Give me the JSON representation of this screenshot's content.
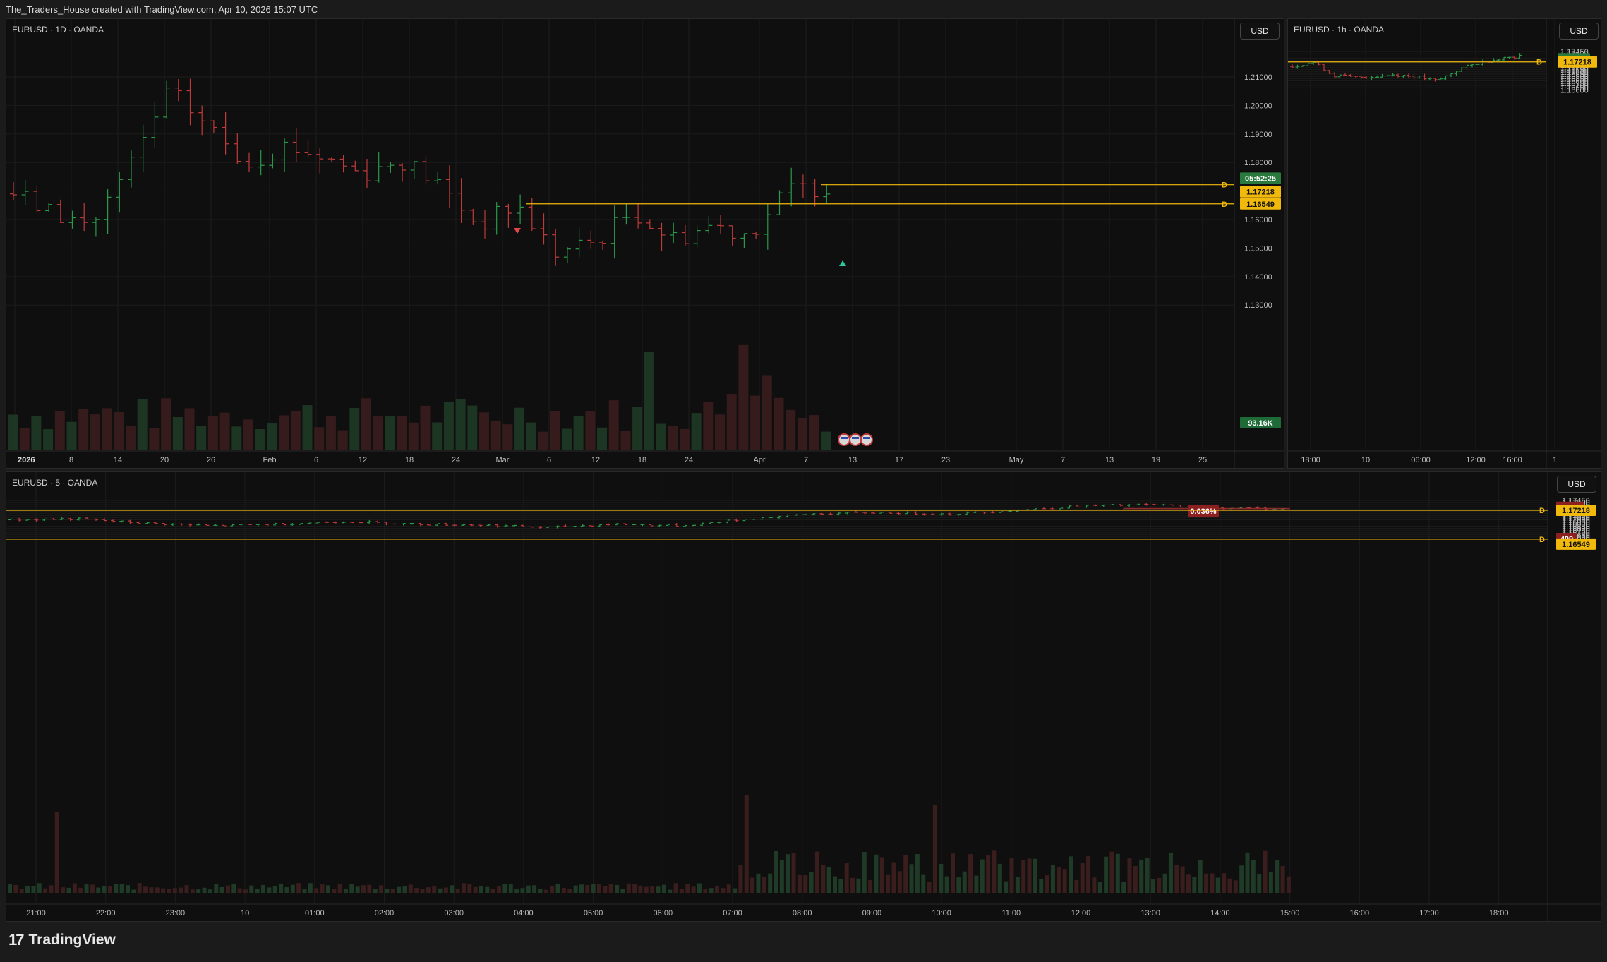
{
  "header": {
    "text": "The_Traders_House created with TradingView.com, Apr 10, 2026 15:07 UTC"
  },
  "footer": {
    "brand": "TradingView",
    "logo_glyph": "17"
  },
  "colors": {
    "up": "#2a9a4a",
    "down": "#c03a3a",
    "level": "#f0b90b",
    "grid": "#1c1c1c",
    "text": "#bdbdbd"
  },
  "currency_button": "USD",
  "pane_daily": {
    "legend": "EURUSD · 1D · OANDA",
    "price_ticks": [
      "1.21000",
      "1.20000",
      "1.19000",
      "1.18000",
      "1.16000",
      "1.15000",
      "1.14000",
      "1.13000"
    ],
    "time_labels": [
      "2026",
      "8",
      "14",
      "20",
      "26",
      "Feb",
      "6",
      "12",
      "18",
      "24",
      "Mar",
      "6",
      "12",
      "18",
      "24",
      "Apr",
      "7",
      "13",
      "17",
      "23",
      "May",
      "7",
      "13",
      "19",
      "25"
    ],
    "badges": {
      "countdown": "05:52:25",
      "price1": "1.17218",
      "price2": "1.16549",
      "volume": "93.16K"
    },
    "level_markers": [
      "D",
      "D"
    ],
    "event_icons": [
      "us-flag-icon",
      "us-flag-icon",
      "us-flag-icon"
    ]
  },
  "pane_hourly": {
    "legend": "EURUSD · 1h · OANDA",
    "price_ticks": [
      "1.17450",
      "1.17400",
      "1.17350",
      "1.17300",
      "1.17250",
      "1.17200",
      "1.17150",
      "1.17100",
      "1.17050",
      "1.17000",
      "1.16950",
      "1.16900",
      "1.16850",
      "1.16800",
      "1.16750",
      "1.16700",
      "1.16650",
      "1.16600"
    ],
    "time_labels": [
      "18:00",
      "10",
      "06:00",
      "12:00",
      "16:00",
      "1"
    ],
    "badges": {
      "countdown": "52:26",
      "price": "1.17218"
    },
    "level_marker": "D"
  },
  "pane_5min": {
    "legend": "EURUSD · 5 · OANDA",
    "price_ticks": [
      "1.17450",
      "1.17400",
      "1.17350",
      "1.17300",
      "1.17250",
      "1.17200",
      "1.17150",
      "1.17100",
      "1.17050",
      "1.17000",
      "1.16950",
      "1.16900",
      "1.16850",
      "1.16800",
      "1.16750",
      "1.16700",
      "1.16650",
      "1.16600",
      "1.16550"
    ],
    "time_labels": [
      "21:00",
      "22:00",
      "23:00",
      "10",
      "01:00",
      "02:00",
      "03:00",
      "04:00",
      "05:00",
      "06:00",
      "07:00",
      "08:00",
      "09:00",
      "10:00",
      "11:00",
      "12:00",
      "13:00",
      "14:00",
      "15:00",
      "16:00",
      "17:00",
      "18:00"
    ],
    "badges": {
      "countdown": "02:26",
      "price1": "1.17218",
      "volume": "409",
      "price2": "1.16549"
    },
    "measure_label": "0.036%",
    "level_markers": [
      "D",
      "D"
    ]
  }
}
